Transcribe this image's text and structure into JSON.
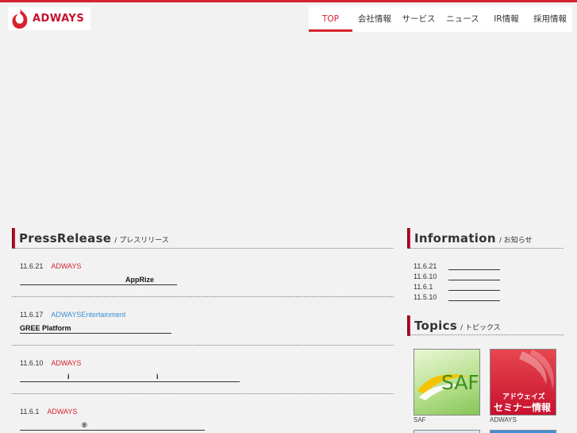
{
  "header": {
    "logo_text": "ADWAYS"
  },
  "nav": {
    "items": [
      {
        "label": "TOP",
        "active": true
      },
      {
        "label": "会社情報"
      },
      {
        "label": "サービス"
      },
      {
        "label": "ニュース"
      },
      {
        "label": "IR情報"
      },
      {
        "label": "採用情報"
      }
    ]
  },
  "press": {
    "title": "PressRelease",
    "subtitle": "/ プレスリリース",
    "items": [
      {
        "date": "11.6.21",
        "category": "ADWAYS",
        "link_text": "AppRize"
      },
      {
        "date": "11.6.17",
        "category": "ADWAYSEntertainment",
        "link_text": "GREE Platform"
      },
      {
        "date": "11.6.10",
        "category": "ADWAYS",
        "link_text": "i",
        "link_text_2": "i"
      },
      {
        "date": "11.6.1",
        "category": "ADWAYS",
        "link_text": "®"
      }
    ]
  },
  "information": {
    "title": "Information",
    "subtitle": "/ お知らせ",
    "dates": [
      "11.6.21",
      "11.6.10",
      "11.6.1",
      "11.5.10"
    ]
  },
  "topics": {
    "title": "Topics",
    "subtitle": "/ トピックス",
    "banners": [
      {
        "image_text": "SAF",
        "caption": "SAF"
      },
      {
        "image_text_1": "アドウェイズ",
        "image_text_2": "セミナー情報",
        "caption": "ADWAYS"
      }
    ]
  },
  "colors": {
    "accent": "#d6232e",
    "link_blue": "#3a8fd4",
    "background": "#f2f2f2"
  }
}
